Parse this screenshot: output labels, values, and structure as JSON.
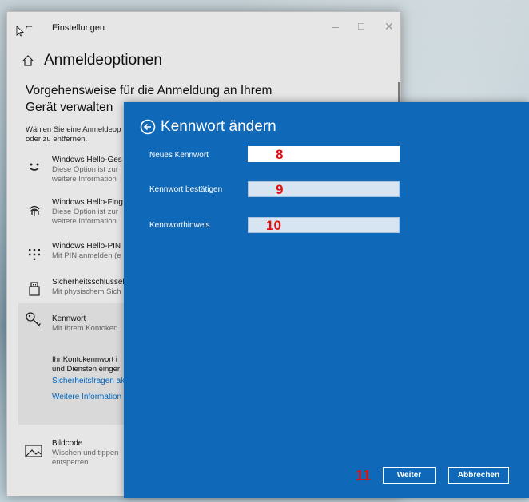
{
  "settings": {
    "window_title": "Einstellungen",
    "page_title": "Anmeldeoptionen",
    "subtitle": "Vorgehensweise für die Anmeldung an Ihrem Gerät verwalten",
    "intro_line1": "Wählen Sie eine Anmeldeop",
    "intro_line2": "oder zu entfernen.",
    "options": [
      {
        "icon": "smiley-face-icon",
        "title": "Windows Hello-Ges",
        "desc1": "Diese Option ist zur",
        "desc2": "weitere Information"
      },
      {
        "icon": "fingerprint-icon",
        "title": "Windows Hello-Fing",
        "desc1": "Diese Option ist zur",
        "desc2": "weitere Information"
      },
      {
        "icon": "pin-keypad-icon",
        "title": "Windows Hello-PIN",
        "desc1": "Mit PIN anmelden (e",
        "desc2": ""
      },
      {
        "icon": "security-key-icon",
        "title": "Sicherheitsschlüssel",
        "desc1": "Mit physischem Sich",
        "desc2": ""
      },
      {
        "icon": "key-icon",
        "title": "Kennwort",
        "desc1": "Mit Ihrem Kontoken",
        "desc2": ""
      },
      {
        "icon": "picture-password-icon",
        "title": "Bildcode",
        "desc1": "Wischen und tippen",
        "desc2": "entsperren"
      }
    ],
    "kennwort_body1": "Ihr Kontokennwort i",
    "kennwort_body2": "und Diensten einger",
    "link_security_questions": "Sicherheitsfragen ak",
    "link_more_info": "Weitere Information"
  },
  "dialog": {
    "title": "Kennwort ändern",
    "fields": [
      {
        "label": "Neues Kennwort",
        "marker": "8"
      },
      {
        "label": "Kennwort bestätigen",
        "marker": "9"
      },
      {
        "label": "Kennworthinweis",
        "marker": "10"
      }
    ],
    "step_marker": "11",
    "next_button": "Weiter",
    "cancel_button": "Abbrechen"
  },
  "colors": {
    "dialog_bg": "#0f69b8",
    "marker_red": "#e01010",
    "link_blue": "#0067c0"
  }
}
